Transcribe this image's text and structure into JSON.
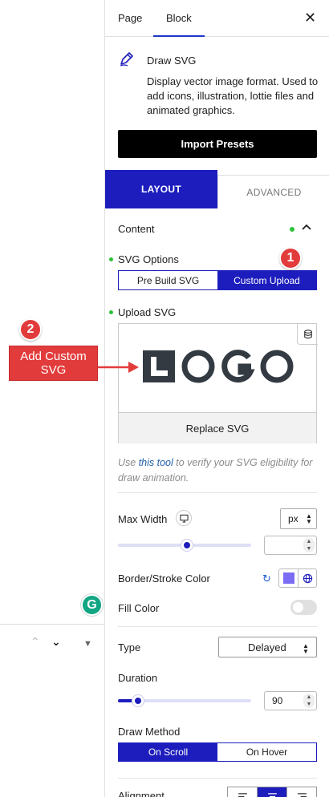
{
  "sidebar": {
    "tabs": {
      "page": "Page",
      "block": "Block"
    },
    "block": {
      "title": "Draw SVG",
      "description": "Display vector image format. Used to add icons, illustration, lottie files and animated graphics."
    },
    "import_presets": "Import Presets",
    "panel_tabs": {
      "layout": "LAYOUT",
      "advanced": "ADVANCED"
    },
    "content_label": "Content",
    "svg_options": {
      "label": "SVG Options",
      "options": [
        "Pre Build SVG",
        "Custom Upload"
      ],
      "selected": "Custom Upload"
    },
    "upload": {
      "label": "Upload SVG",
      "replace_label": "Replace SVG"
    },
    "help": {
      "prefix": "Use ",
      "link": "this tool",
      "suffix": " to verify your SVG eligibility for draw animation."
    },
    "max_width": {
      "label": "Max Width",
      "unit": "px",
      "value": "",
      "slider_fraction": 0.52
    },
    "border_color": {
      "label": "Border/Stroke Color",
      "color": "#7b6cf4"
    },
    "fill_color": {
      "label": "Fill Color",
      "enabled": false
    },
    "type": {
      "label": "Type",
      "value": "Delayed"
    },
    "duration": {
      "label": "Duration",
      "value": "90",
      "slider_fraction": 0.15
    },
    "draw_method": {
      "label": "Draw Method",
      "options": [
        "On Scroll",
        "On Hover"
      ],
      "selected": "On Scroll"
    },
    "alignment": {
      "label": "Alignment",
      "selected": "center"
    }
  },
  "annotations": {
    "badge_1": "1",
    "badge_2": "2",
    "callout": "Add Custom SVG"
  },
  "colors": {
    "accent": "#1d1dbe",
    "callout": "#e23b3b",
    "status_green": "#2cc23a"
  }
}
